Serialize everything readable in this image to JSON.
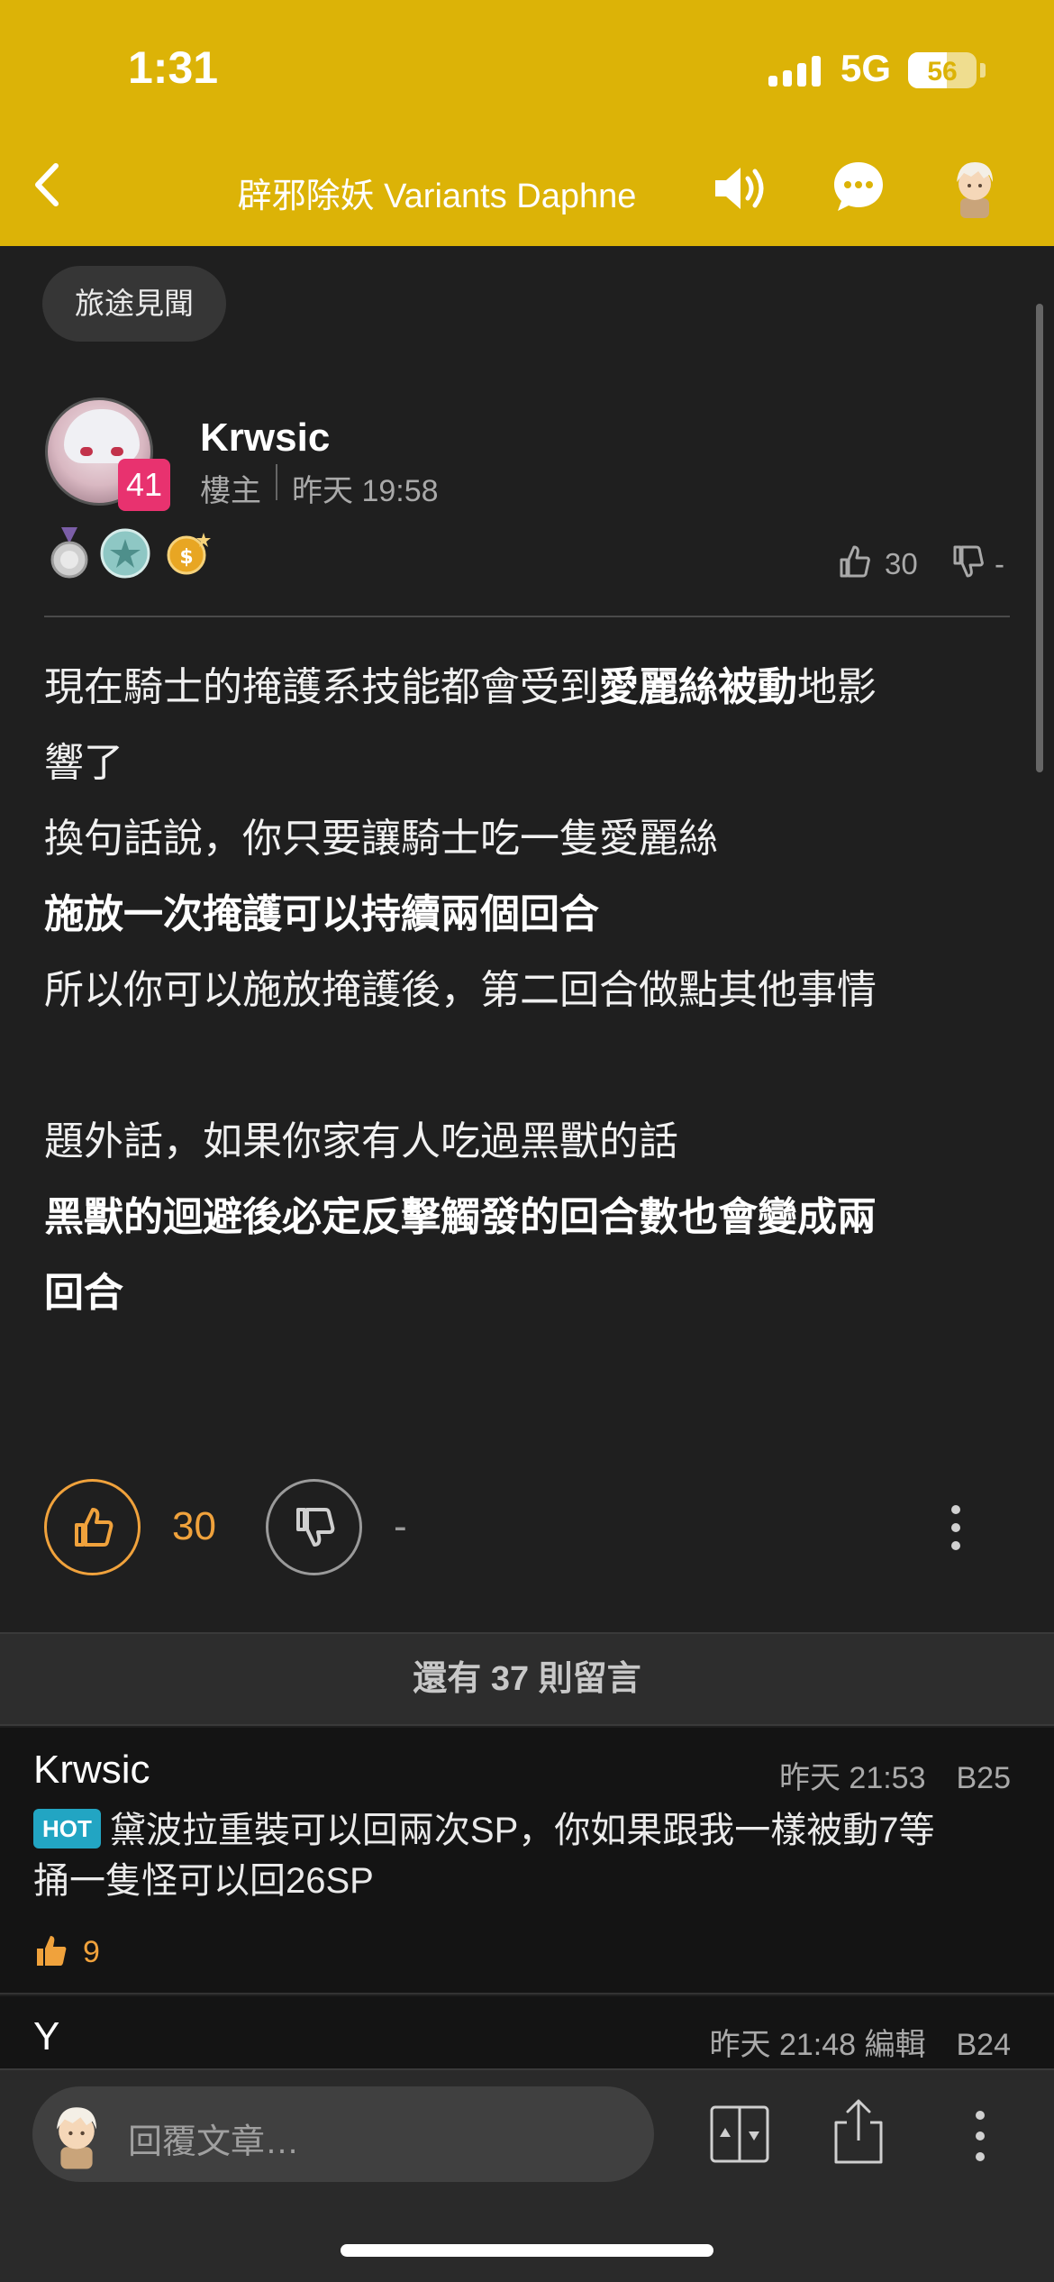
{
  "status_bar": {
    "time": "1:31",
    "network": "5G",
    "battery": "56",
    "battery_level": 0.56
  },
  "nav": {
    "title": "辟邪除妖 Variants Daphne"
  },
  "post": {
    "tag": "旅途見聞",
    "author": {
      "name": "Krwsic",
      "level": "41",
      "role": "樓主",
      "time": "昨天 19:58"
    },
    "header_likes": "30",
    "header_dislikes": "-",
    "lines": [
      [
        {
          "t": "現在騎士的掩護系技能都會受到"
        },
        {
          "t": "愛麗絲被動",
          "b": true
        },
        {
          "t": "地影"
        }
      ],
      [
        {
          "t": "響了"
        }
      ],
      [
        {
          "t": "換句話說，你只要讓騎士吃一隻愛麗絲"
        }
      ],
      [
        {
          "t": "施放一次掩護可以持續兩個回合",
          "b": true
        }
      ],
      [
        {
          "t": "所以你可以施放掩護後，第二回合做點其他事情"
        }
      ],
      [
        {
          "t": "題外話，如果你家有人吃過黑獸的話"
        }
      ],
      [
        {
          "t": "黑獸的迴避後必定反擊觸發的回合數也會變成兩",
          "b": true
        }
      ],
      [
        {
          "t": "回合",
          "b": true
        }
      ]
    ],
    "likes": "30",
    "dislikes": "-"
  },
  "comments_bar": {
    "label": "還有 37 則留言"
  },
  "comments": [
    {
      "name": "Krwsic",
      "meta": "昨天 21:53　B25",
      "badge": "HOT",
      "text_line1": "黛波拉重裝可以回兩次SP，你如果跟我一樣被動7等",
      "text_line2": "捅一隻怪可以回26SP",
      "likes": "9"
    },
    {
      "name": "Y",
      "meta": "昨天 21:48 編輯　B24"
    }
  ],
  "bottom_bar": {
    "reply_placeholder": "回覆文章…"
  },
  "colors": {
    "brand": "#dcb307",
    "like": "#f0a23c",
    "level_badge": "#e8326f",
    "hot_badge": "#22a5c3"
  }
}
